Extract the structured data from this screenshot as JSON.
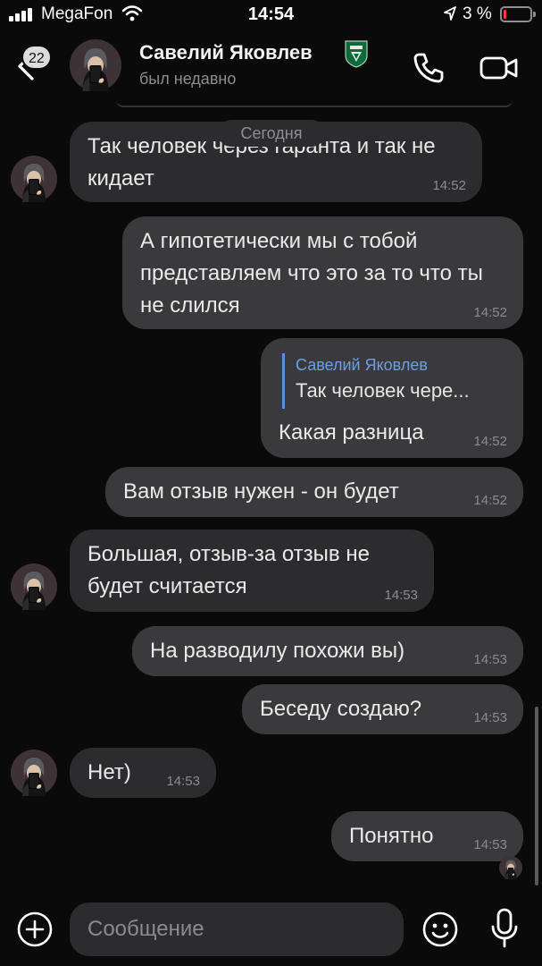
{
  "status_bar": {
    "carrier": "MegaFon",
    "time": "14:54",
    "battery_percent": "3 %",
    "battery_level": 0.03
  },
  "header": {
    "unread_count": "22",
    "contact_name": "Савелий Яковлев",
    "contact_status": "был недавно"
  },
  "chat": {
    "date_separator": "Сегодня",
    "messages": [
      {
        "direction": "in",
        "text": "Так человек через гаранта и так не кидает",
        "time": "14:52"
      },
      {
        "direction": "out",
        "text": "А гипотетически мы с тобой представляем что это за то что ты не слился",
        "time": "14:52"
      },
      {
        "direction": "out",
        "reply_author": "Савелий Яковлев",
        "reply_snippet": "Так человек чере...",
        "text": "Какая разница",
        "time": "14:52"
      },
      {
        "direction": "out",
        "text": "Вам отзыв нужен - он будет",
        "time": "14:52"
      },
      {
        "direction": "in",
        "text": "Большая, отзыв-за отзыв не будет считается",
        "time": "14:53"
      },
      {
        "direction": "out",
        "text": "На разводилу похожи вы)",
        "time": "14:53"
      },
      {
        "direction": "out",
        "text": "Беседу создаю?",
        "time": "14:53"
      },
      {
        "direction": "in",
        "text": "Нет)",
        "time": "14:53"
      },
      {
        "direction": "out",
        "text": "Понятно",
        "time": "14:53"
      }
    ]
  },
  "composer": {
    "placeholder": "Сообщение",
    "value": ""
  },
  "colors": {
    "background": "#0a0a0a",
    "incoming_bubble": "#2c2c2e",
    "outgoing_bubble": "#3a3a3c",
    "reply_accent": "#6e9ee8",
    "battery_low": "#ff3b30"
  },
  "icons": [
    "signal-icon",
    "wifi-icon",
    "location-arrow-icon",
    "battery-icon",
    "back-chevron-icon",
    "club-badge-icon",
    "phone-icon",
    "video-camera-icon",
    "plus-icon",
    "emoji-icon",
    "microphone-icon"
  ]
}
